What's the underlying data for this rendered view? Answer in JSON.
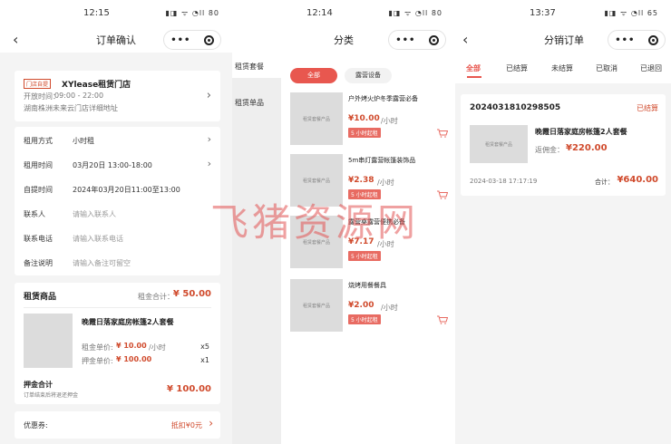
{
  "panels": {
    "order": {
      "status_time": "12:15",
      "status_icons": "▮◨ ᯤ ◔ll 80",
      "back": "‹",
      "title": "订单确认",
      "capsule_dots": "•••",
      "store": {
        "tag": "门店自提",
        "name": "XYlease租赁门店",
        "hours_label": "开放时间：",
        "hours": "09:00 - 22:00",
        "address": "湖南株洲未来云门店详细地址"
      },
      "fields": [
        {
          "label": "租用方式",
          "value": "小时租",
          "chev": "›"
        },
        {
          "label": "租用时间",
          "value": "03月20日 13:00-18:00",
          "chev": "›"
        },
        {
          "label": "自提时间",
          "value": "2024年03月20日11:00至13:00",
          "chev": ""
        },
        {
          "label": "联系人",
          "placeholder": "请输入联系人"
        },
        {
          "label": "联系电话",
          "placeholder": "请输入联系电话"
        },
        {
          "label": "备注说明",
          "placeholder": "请输入备注可留空"
        }
      ],
      "goods": {
        "header": "租赁商品",
        "total_label": "租金合计：",
        "total": "¥ 50.00",
        "item_name": "晚霞日落家庭房帐篷2人套餐",
        "rent_label": "租金单价:",
        "rent_price": "¥ 10.00",
        "rent_unit": "/小时",
        "rent_qty": "x5",
        "deposit_label": "押金单价:",
        "deposit_price": "¥ 100.00",
        "deposit_qty": "x1",
        "deposit_total_title": "押金合计",
        "deposit_total_note": "订单结束后将退还押金",
        "deposit_total": "¥ 100.00"
      },
      "coupon": {
        "label": "优惠券:",
        "value": "抵扣¥0元",
        "chev": "›"
      }
    },
    "category": {
      "status_time": "12:14",
      "status_icons": "▮◨ ᯤ ◔ll 80",
      "title": "分类",
      "capsule_dots": "•••",
      "sidebar": [
        "租赁套餐",
        "租赁单品"
      ],
      "tabs": [
        "全部",
        "露营设备"
      ],
      "thumb_text": "租赁套餐产品",
      "products": [
        {
          "name": "户外烤火炉冬季露营必备",
          "price": "¥10.00",
          "unit": "/小时",
          "badge": "5 小时起租"
        },
        {
          "name": "5m串灯露营帐篷装饰品",
          "price": "¥2.38",
          "unit": "/小时",
          "badge": "5 小时起租"
        },
        {
          "name": "露营桌露营便携必备",
          "price": "¥7.17",
          "unit": "/小时",
          "badge": "5 小时起租"
        },
        {
          "name": "烧烤用餐餐具",
          "price": "¥2.00",
          "unit": "/小时",
          "badge": "5 小时起租"
        }
      ]
    },
    "distribution": {
      "status_time": "13:37",
      "status_icons": "▮◨ ᯤ ◔ll 65",
      "back": "‹",
      "title": "分销订单",
      "capsule_dots": "•••",
      "tabs": [
        "全部",
        "已结算",
        "未结算",
        "已取消",
        "已退回"
      ],
      "order": {
        "id": "2024031810298505",
        "status": "已结算",
        "thumb_text": "租赁套餐产品",
        "name": "晚霞日落家庭房帐篷2人套餐",
        "commission_label": "返佣金：",
        "commission": "¥220.00",
        "date": "2024-03-18 17:17:19",
        "total_label": "合计：",
        "total": "¥640.00"
      }
    }
  },
  "watermark": "飞猪资源网",
  "colors": {
    "accent": "#d04a2c",
    "tab_active": "#e8574f",
    "badge": "#e86b62"
  }
}
